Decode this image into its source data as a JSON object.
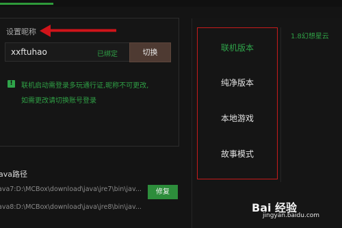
{
  "settings": {
    "nickname_label": "设置昵称",
    "nickname_value": "xxftuhao",
    "bound_status": "已绑定",
    "switch_button": "切换",
    "notice_icon": "!",
    "notice_line1": "联机启动需登录多玩通行证,昵称不可更改,",
    "notice_line2": "如需更改请切换账号登录"
  },
  "java": {
    "title": "ava路径",
    "paths": [
      "ava7:D:\\MCBox\\download\\java\\jre7\\bin\\jav...",
      "ava8:D:\\MCBox\\download\\java\\jre8\\bin\\jav..."
    ],
    "repair_button": "修复"
  },
  "mode_menu": {
    "items": [
      "联机版本",
      "纯净版本",
      "本地游戏",
      "故事模式"
    ]
  },
  "versions": {
    "items": [
      "1.8幻想星云"
    ]
  },
  "watermark": {
    "logo": "Bai 经验",
    "url": "jingyan.baidu.com"
  },
  "colors": {
    "accent_green": "#2fa44a",
    "annotation_red": "#c81b1b",
    "switch_button": "#4e3a32"
  }
}
